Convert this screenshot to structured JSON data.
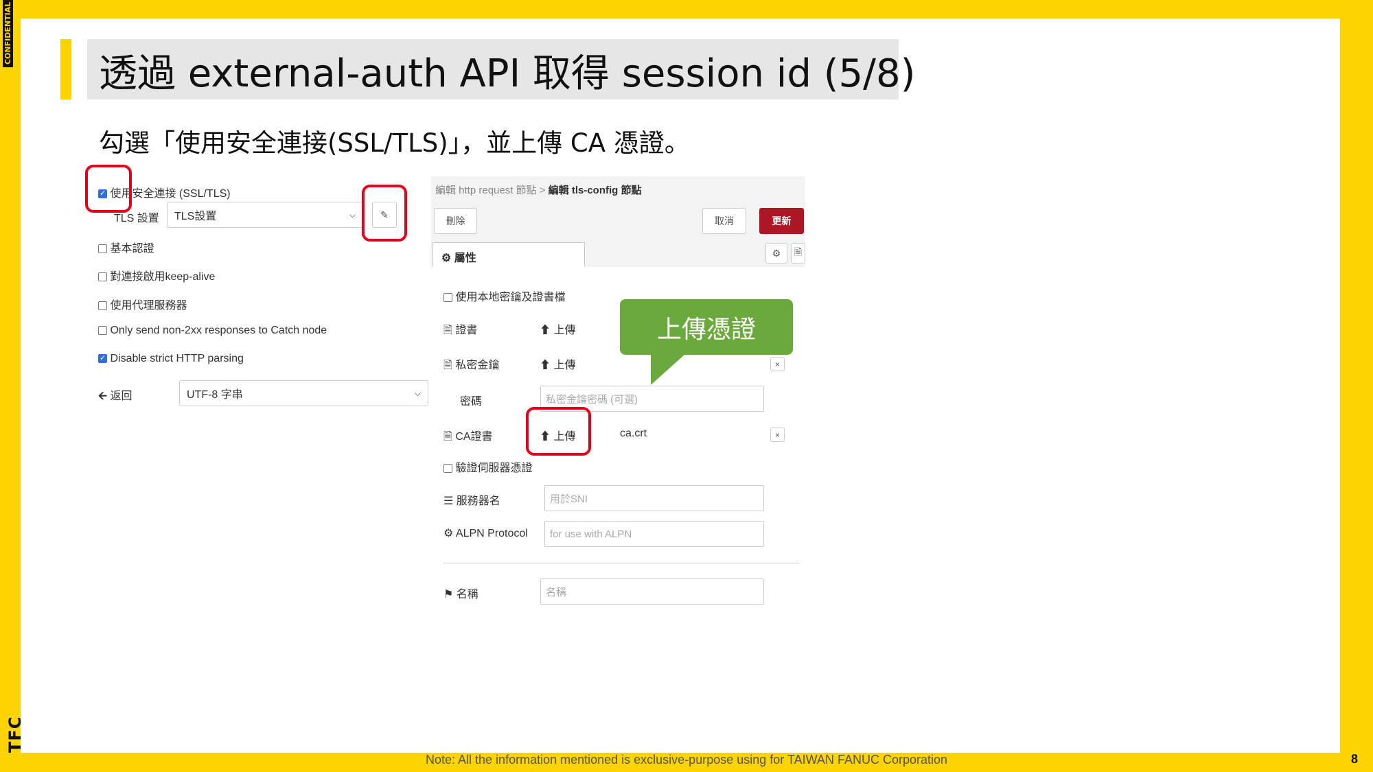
{
  "slide": {
    "confidential": "CONFIDENTIAL",
    "brand": "TFC",
    "title": "透過 external-auth API 取得 session id (5/8)",
    "subtitle": "勾選「使用安全連接(SSL/TLS)」，並上傳 CA 憑證。",
    "footer": "Note: All the information mentioned is exclusive-purpose using for TAIWAN FANUC Corporation",
    "page_number": "8",
    "accent_color": "#fdd400",
    "highlight_color": "#e4001b"
  },
  "http_request": {
    "ssl_checkbox": {
      "label": "使用安全連接 (SSL/TLS)",
      "checked": true
    },
    "tls_label": "TLS 設置",
    "tls_select_value": "TLS設置",
    "edit_icon": "pencil-icon",
    "options": [
      {
        "label": "基本認證",
        "checked": false
      },
      {
        "label": "對連接啟用keep-alive",
        "checked": false
      },
      {
        "label": "使用代理服務器",
        "checked": false
      },
      {
        "label": "Only send non-2xx responses to Catch node",
        "checked": false
      },
      {
        "label": "Disable strict HTTP parsing",
        "checked": true
      }
    ],
    "return_label": "返回",
    "return_icon": "arrow-left-icon",
    "return_select_value": "UTF-8 字串"
  },
  "tls_config": {
    "breadcrumb_parent": "編輯 http request 節點",
    "breadcrumb_sep": ">",
    "breadcrumb_current": "編輯 tls-config 節點",
    "delete_label": "刪除",
    "cancel_label": "取消",
    "update_label": "更新",
    "update_color": "#ad1625",
    "tab_label": "屬性",
    "tab_icon": "gear-icon",
    "local_files": {
      "label": "使用本地密鑰及證書檔",
      "checked": false
    },
    "cert_label": "證書",
    "cert_upload": "上傳",
    "key_label": "私密金鑰",
    "key_upload": "上傳",
    "passphrase_label": "密碼",
    "passphrase_placeholder": "私密金鑰密碼 (可選)",
    "ca_label": "CA證書",
    "ca_upload": "上傳",
    "ca_filename": "ca.crt",
    "verify": {
      "label": "驗證伺服器憑證",
      "checked": false
    },
    "servername_label": "服務器名",
    "servername_placeholder": "用於SNI",
    "alpn_label": "ALPN Protocol",
    "alpn_placeholder": "for use with ALPN",
    "name_label": "名稱",
    "name_placeholder": "名稱",
    "callout": "上傳憑證",
    "callout_color": "#6aaa3c"
  }
}
